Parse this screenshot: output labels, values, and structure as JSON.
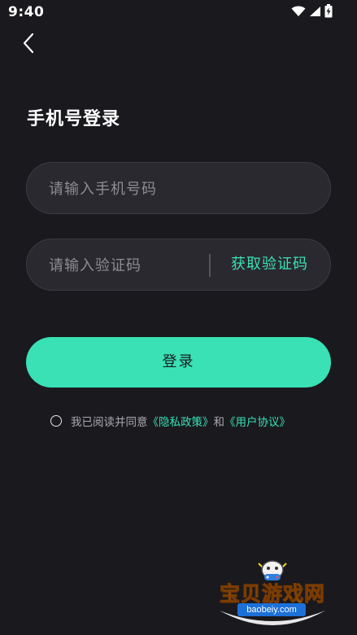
{
  "status_bar": {
    "time": "9:40",
    "icons": [
      "wifi-icon",
      "signal-icon",
      "battery-charging-icon"
    ]
  },
  "header": {
    "back_icon": "chevron-left-icon"
  },
  "title": "手机号登录",
  "phone_field": {
    "placeholder": "请输入手机号码",
    "value": ""
  },
  "code_field": {
    "placeholder": "请输入验证码",
    "value": "",
    "get_code_label": "获取验证码"
  },
  "login_button": {
    "label": "登录"
  },
  "agreement": {
    "prefix": "我已阅读并同意",
    "privacy_link": "《隐私政策》",
    "and": "和",
    "terms_link": "《用户协议》",
    "checked": false
  },
  "watermark": {
    "name": "宝贝游戏网",
    "url": "baobeiy.com"
  },
  "colors": {
    "background": "#1a191e",
    "accent": "#39e1b5",
    "field_bg": "#2a292f",
    "placeholder": "#8e8d93"
  }
}
